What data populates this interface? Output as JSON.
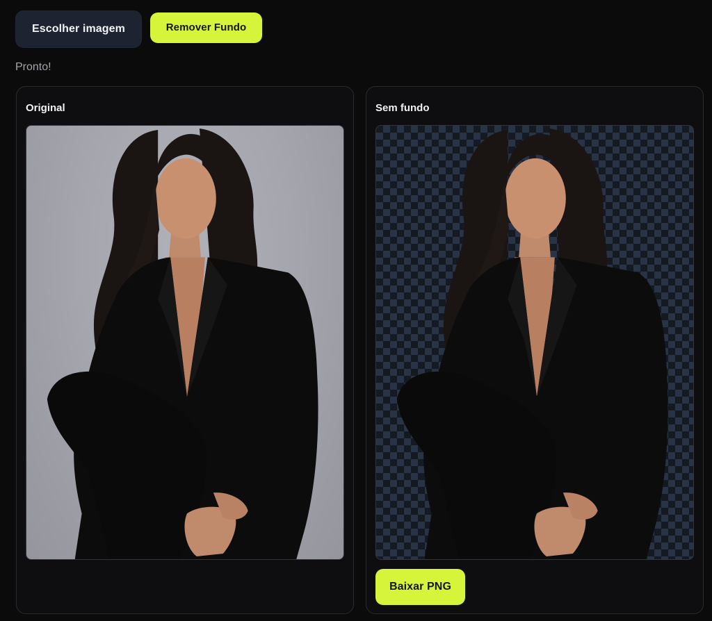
{
  "toolbar": {
    "choose_label": "Escolher imagem",
    "remove_label": "Remover Fundo"
  },
  "status": {
    "text": "Pronto!"
  },
  "panels": {
    "original": {
      "title": "Original"
    },
    "result": {
      "title": "Sem fundo",
      "download_label": "Baixar PNG"
    }
  },
  "colors": {
    "accent": "#d5f43a",
    "secondary_button": "#1d2330",
    "page_background": "#0b0b0c",
    "checker_light": "#283345",
    "checker_dark": "#151a22",
    "studio_background": "#a5a6ae"
  }
}
